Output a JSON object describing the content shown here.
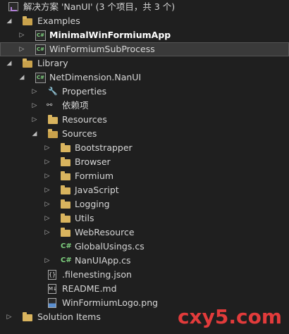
{
  "solution": {
    "title": "解决方案 'NanUI' (3 个项目，共 3 个)"
  },
  "tree": {
    "examples_folder": "Examples",
    "minimal_app": "MinimalWinFormiumApp",
    "subprocess": "WinFormiumSubProcess",
    "library_folder": "Library",
    "nanui_project": "NetDimension.NanUI",
    "properties": "Properties",
    "dependencies": "依赖项",
    "resources": "Resources",
    "sources": "Sources",
    "bootstrapper": "Bootstrapper",
    "browser": "Browser",
    "formium": "Formium",
    "javascript": "JavaScript",
    "logging": "Logging",
    "utils": "Utils",
    "webresource": "WebResource",
    "globalusings": "GlobalUsings.cs",
    "nanuiapp": "NanUIApp.cs",
    "filenesting": ".filenesting.json",
    "readme": "README.md",
    "logo": "WinFormiumLogo.png",
    "solution_items": "Solution Items"
  },
  "icons": {
    "cs_badge": "C#",
    "json_glyph": "{}",
    "md_glyph": "M↓"
  },
  "watermark": "cxy5.com",
  "colors": {
    "background": "#1f1f1f",
    "folder": "#d9b45e",
    "csharp": "#7ed07e",
    "selection": "#3a3a3a",
    "watermark": "#e23b3b"
  }
}
